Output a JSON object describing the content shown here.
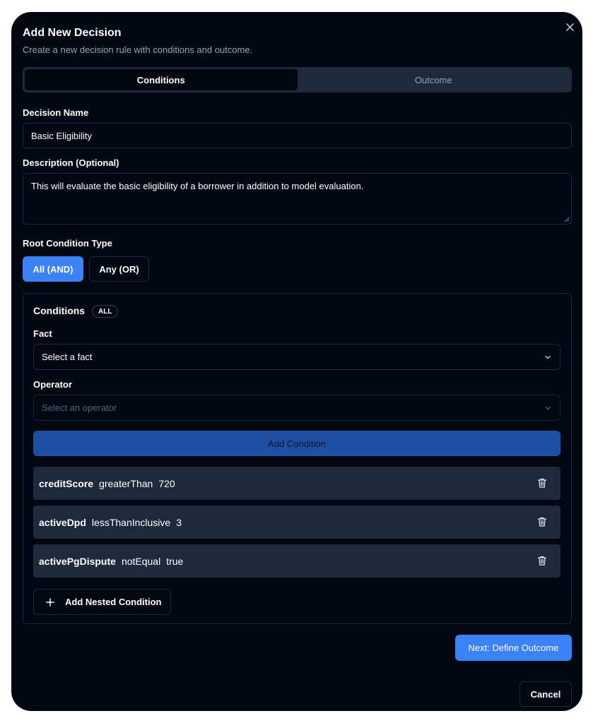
{
  "dialog": {
    "title": "Add New Decision",
    "subtitle": "Create a new decision rule with conditions and outcome."
  },
  "tabs": [
    {
      "label": "Conditions",
      "active": true
    },
    {
      "label": "Outcome",
      "active": false
    }
  ],
  "form": {
    "name_label": "Decision Name",
    "name_value": "Basic Eligibility",
    "description_label": "Description (Optional)",
    "description_value": "This will evaluate the basic eligibility of a borrower in addition to model evaluation."
  },
  "root_condition": {
    "label": "Root Condition Type",
    "options": [
      {
        "label": "All (AND)",
        "selected": true
      },
      {
        "label": "Any (OR)",
        "selected": false
      }
    ]
  },
  "conditions_panel": {
    "title": "Conditions",
    "badge": "ALL",
    "fact_label": "Fact",
    "fact_placeholder": "Select a fact",
    "operator_label": "Operator",
    "operator_placeholder": "Select an operator",
    "add_button": "Add Condition",
    "rows": [
      {
        "fact": "creditScore",
        "operator": "greaterThan",
        "value": "720"
      },
      {
        "fact": "activeDpd",
        "operator": "lessThanInclusive",
        "value": "3"
      },
      {
        "fact": "activePgDispute",
        "operator": "notEqual",
        "value": "true"
      }
    ],
    "nested_button": "Add Nested Condition"
  },
  "actions": {
    "next": "Next: Define Outcome",
    "cancel": "Cancel"
  },
  "colors": {
    "background": "#030712",
    "surface": "#1e293b",
    "accent": "#3b82f6",
    "accent_muted": "#1e4fa3"
  },
  "icons": [
    "close-icon",
    "chevron-down-icon",
    "trash-icon",
    "plus-icon",
    "resize-handle-icon"
  ]
}
